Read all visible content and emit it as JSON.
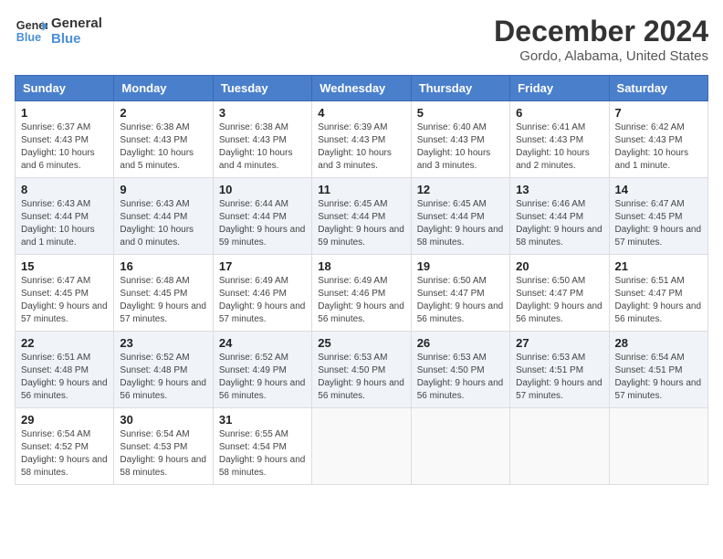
{
  "header": {
    "logo_line1": "General",
    "logo_line2": "Blue",
    "main_title": "December 2024",
    "subtitle": "Gordo, Alabama, United States"
  },
  "days_of_week": [
    "Sunday",
    "Monday",
    "Tuesday",
    "Wednesday",
    "Thursday",
    "Friday",
    "Saturday"
  ],
  "weeks": [
    [
      {
        "date": "1",
        "sunrise": "Sunrise: 6:37 AM",
        "sunset": "Sunset: 4:43 PM",
        "daylight": "Daylight: 10 hours and 6 minutes."
      },
      {
        "date": "2",
        "sunrise": "Sunrise: 6:38 AM",
        "sunset": "Sunset: 4:43 PM",
        "daylight": "Daylight: 10 hours and 5 minutes."
      },
      {
        "date": "3",
        "sunrise": "Sunrise: 6:38 AM",
        "sunset": "Sunset: 4:43 PM",
        "daylight": "Daylight: 10 hours and 4 minutes."
      },
      {
        "date": "4",
        "sunrise": "Sunrise: 6:39 AM",
        "sunset": "Sunset: 4:43 PM",
        "daylight": "Daylight: 10 hours and 3 minutes."
      },
      {
        "date": "5",
        "sunrise": "Sunrise: 6:40 AM",
        "sunset": "Sunset: 4:43 PM",
        "daylight": "Daylight: 10 hours and 3 minutes."
      },
      {
        "date": "6",
        "sunrise": "Sunrise: 6:41 AM",
        "sunset": "Sunset: 4:43 PM",
        "daylight": "Daylight: 10 hours and 2 minutes."
      },
      {
        "date": "7",
        "sunrise": "Sunrise: 6:42 AM",
        "sunset": "Sunset: 4:43 PM",
        "daylight": "Daylight: 10 hours and 1 minute."
      }
    ],
    [
      {
        "date": "8",
        "sunrise": "Sunrise: 6:43 AM",
        "sunset": "Sunset: 4:44 PM",
        "daylight": "Daylight: 10 hours and 1 minute."
      },
      {
        "date": "9",
        "sunrise": "Sunrise: 6:43 AM",
        "sunset": "Sunset: 4:44 PM",
        "daylight": "Daylight: 10 hours and 0 minutes."
      },
      {
        "date": "10",
        "sunrise": "Sunrise: 6:44 AM",
        "sunset": "Sunset: 4:44 PM",
        "daylight": "Daylight: 9 hours and 59 minutes."
      },
      {
        "date": "11",
        "sunrise": "Sunrise: 6:45 AM",
        "sunset": "Sunset: 4:44 PM",
        "daylight": "Daylight: 9 hours and 59 minutes."
      },
      {
        "date": "12",
        "sunrise": "Sunrise: 6:45 AM",
        "sunset": "Sunset: 4:44 PM",
        "daylight": "Daylight: 9 hours and 58 minutes."
      },
      {
        "date": "13",
        "sunrise": "Sunrise: 6:46 AM",
        "sunset": "Sunset: 4:44 PM",
        "daylight": "Daylight: 9 hours and 58 minutes."
      },
      {
        "date": "14",
        "sunrise": "Sunrise: 6:47 AM",
        "sunset": "Sunset: 4:45 PM",
        "daylight": "Daylight: 9 hours and 57 minutes."
      }
    ],
    [
      {
        "date": "15",
        "sunrise": "Sunrise: 6:47 AM",
        "sunset": "Sunset: 4:45 PM",
        "daylight": "Daylight: 9 hours and 57 minutes."
      },
      {
        "date": "16",
        "sunrise": "Sunrise: 6:48 AM",
        "sunset": "Sunset: 4:45 PM",
        "daylight": "Daylight: 9 hours and 57 minutes."
      },
      {
        "date": "17",
        "sunrise": "Sunrise: 6:49 AM",
        "sunset": "Sunset: 4:46 PM",
        "daylight": "Daylight: 9 hours and 57 minutes."
      },
      {
        "date": "18",
        "sunrise": "Sunrise: 6:49 AM",
        "sunset": "Sunset: 4:46 PM",
        "daylight": "Daylight: 9 hours and 56 minutes."
      },
      {
        "date": "19",
        "sunrise": "Sunrise: 6:50 AM",
        "sunset": "Sunset: 4:47 PM",
        "daylight": "Daylight: 9 hours and 56 minutes."
      },
      {
        "date": "20",
        "sunrise": "Sunrise: 6:50 AM",
        "sunset": "Sunset: 4:47 PM",
        "daylight": "Daylight: 9 hours and 56 minutes."
      },
      {
        "date": "21",
        "sunrise": "Sunrise: 6:51 AM",
        "sunset": "Sunset: 4:47 PM",
        "daylight": "Daylight: 9 hours and 56 minutes."
      }
    ],
    [
      {
        "date": "22",
        "sunrise": "Sunrise: 6:51 AM",
        "sunset": "Sunset: 4:48 PM",
        "daylight": "Daylight: 9 hours and 56 minutes."
      },
      {
        "date": "23",
        "sunrise": "Sunrise: 6:52 AM",
        "sunset": "Sunset: 4:48 PM",
        "daylight": "Daylight: 9 hours and 56 minutes."
      },
      {
        "date": "24",
        "sunrise": "Sunrise: 6:52 AM",
        "sunset": "Sunset: 4:49 PM",
        "daylight": "Daylight: 9 hours and 56 minutes."
      },
      {
        "date": "25",
        "sunrise": "Sunrise: 6:53 AM",
        "sunset": "Sunset: 4:50 PM",
        "daylight": "Daylight: 9 hours and 56 minutes."
      },
      {
        "date": "26",
        "sunrise": "Sunrise: 6:53 AM",
        "sunset": "Sunset: 4:50 PM",
        "daylight": "Daylight: 9 hours and 56 minutes."
      },
      {
        "date": "27",
        "sunrise": "Sunrise: 6:53 AM",
        "sunset": "Sunset: 4:51 PM",
        "daylight": "Daylight: 9 hours and 57 minutes."
      },
      {
        "date": "28",
        "sunrise": "Sunrise: 6:54 AM",
        "sunset": "Sunset: 4:51 PM",
        "daylight": "Daylight: 9 hours and 57 minutes."
      }
    ],
    [
      {
        "date": "29",
        "sunrise": "Sunrise: 6:54 AM",
        "sunset": "Sunset: 4:52 PM",
        "daylight": "Daylight: 9 hours and 58 minutes."
      },
      {
        "date": "30",
        "sunrise": "Sunrise: 6:54 AM",
        "sunset": "Sunset: 4:53 PM",
        "daylight": "Daylight: 9 hours and 58 minutes."
      },
      {
        "date": "31",
        "sunrise": "Sunrise: 6:55 AM",
        "sunset": "Sunset: 4:54 PM",
        "daylight": "Daylight: 9 hours and 58 minutes."
      },
      null,
      null,
      null,
      null
    ]
  ]
}
